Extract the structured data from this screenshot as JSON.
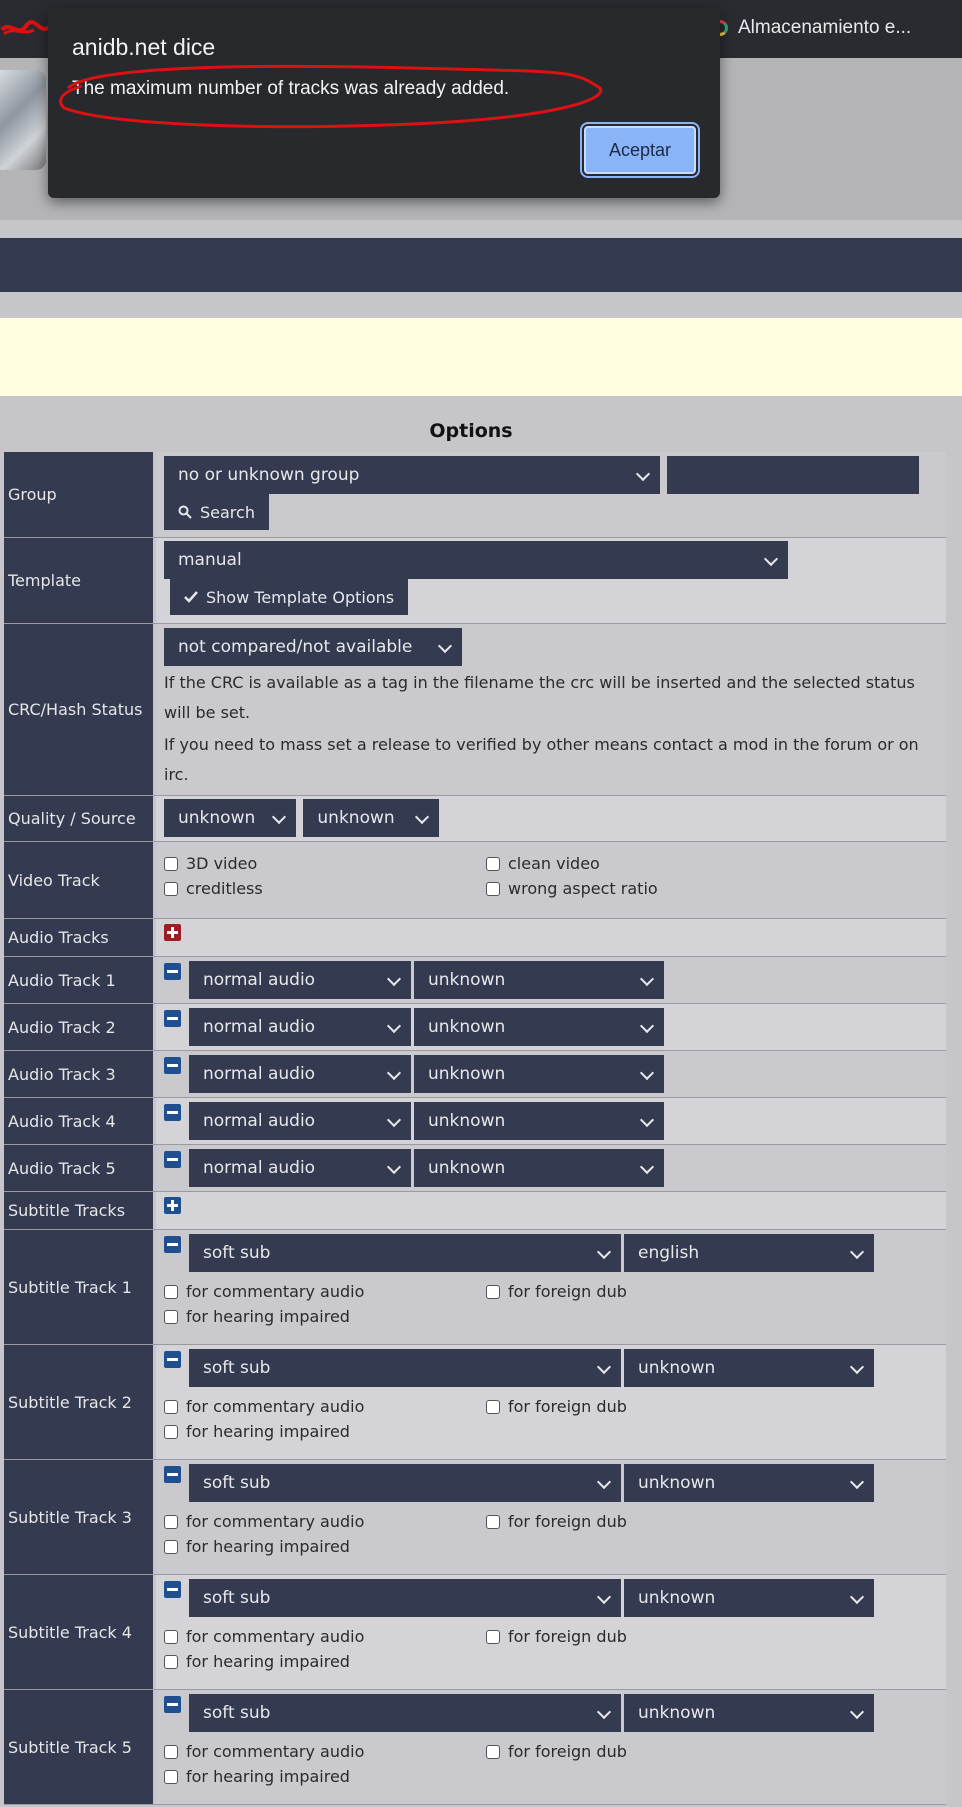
{
  "browser": {
    "bookmark_label": "Almacenamiento e..."
  },
  "dialog": {
    "title": "anidb.net dice",
    "message": "The maximum number of tracks was already added.",
    "ok_label": "Aceptar"
  },
  "options": {
    "title": "Options",
    "group": {
      "label": "Group",
      "select": "no or unknown group",
      "search_label": "Search"
    },
    "template": {
      "label": "Template",
      "select": "manual",
      "show_label": "Show Template Options"
    },
    "crc": {
      "label": "CRC/Hash Status",
      "select": "not compared/not available",
      "note1": "If the CRC is available as a tag in the filename the crc will be inserted and the selected status will be set.",
      "note2": "If you need to mass set a release to verified by other means contact a mod in the forum or on irc."
    },
    "quality": {
      "label": "Quality / Source",
      "quality": "unknown",
      "source": "unknown"
    },
    "video": {
      "label": "Video Track",
      "opt1": "3D video",
      "opt2": "clean video",
      "opt3": "creditless",
      "opt4": "wrong aspect ratio"
    },
    "audio_tracks_label": "Audio Tracks",
    "audio": [
      {
        "label": "Audio Track 1",
        "type": "normal audio",
        "lang": "unknown"
      },
      {
        "label": "Audio Track 2",
        "type": "normal audio",
        "lang": "unknown"
      },
      {
        "label": "Audio Track 3",
        "type": "normal audio",
        "lang": "unknown"
      },
      {
        "label": "Audio Track 4",
        "type": "normal audio",
        "lang": "unknown"
      },
      {
        "label": "Audio Track 5",
        "type": "normal audio",
        "lang": "unknown"
      }
    ],
    "subtitle_tracks_label": "Subtitle Tracks",
    "sub_opts": {
      "commentary": "for commentary audio",
      "foreign": "for foreign dub",
      "hearing": "for hearing impaired"
    },
    "subs": [
      {
        "label": "Subtitle Track 1",
        "type": "soft sub",
        "lang": "english"
      },
      {
        "label": "Subtitle Track 2",
        "type": "soft sub",
        "lang": "unknown"
      },
      {
        "label": "Subtitle Track 3",
        "type": "soft sub",
        "lang": "unknown"
      },
      {
        "label": "Subtitle Track 4",
        "type": "soft sub",
        "lang": "unknown"
      },
      {
        "label": "Subtitle Track 5",
        "type": "soft sub",
        "lang": "unknown"
      }
    ]
  }
}
